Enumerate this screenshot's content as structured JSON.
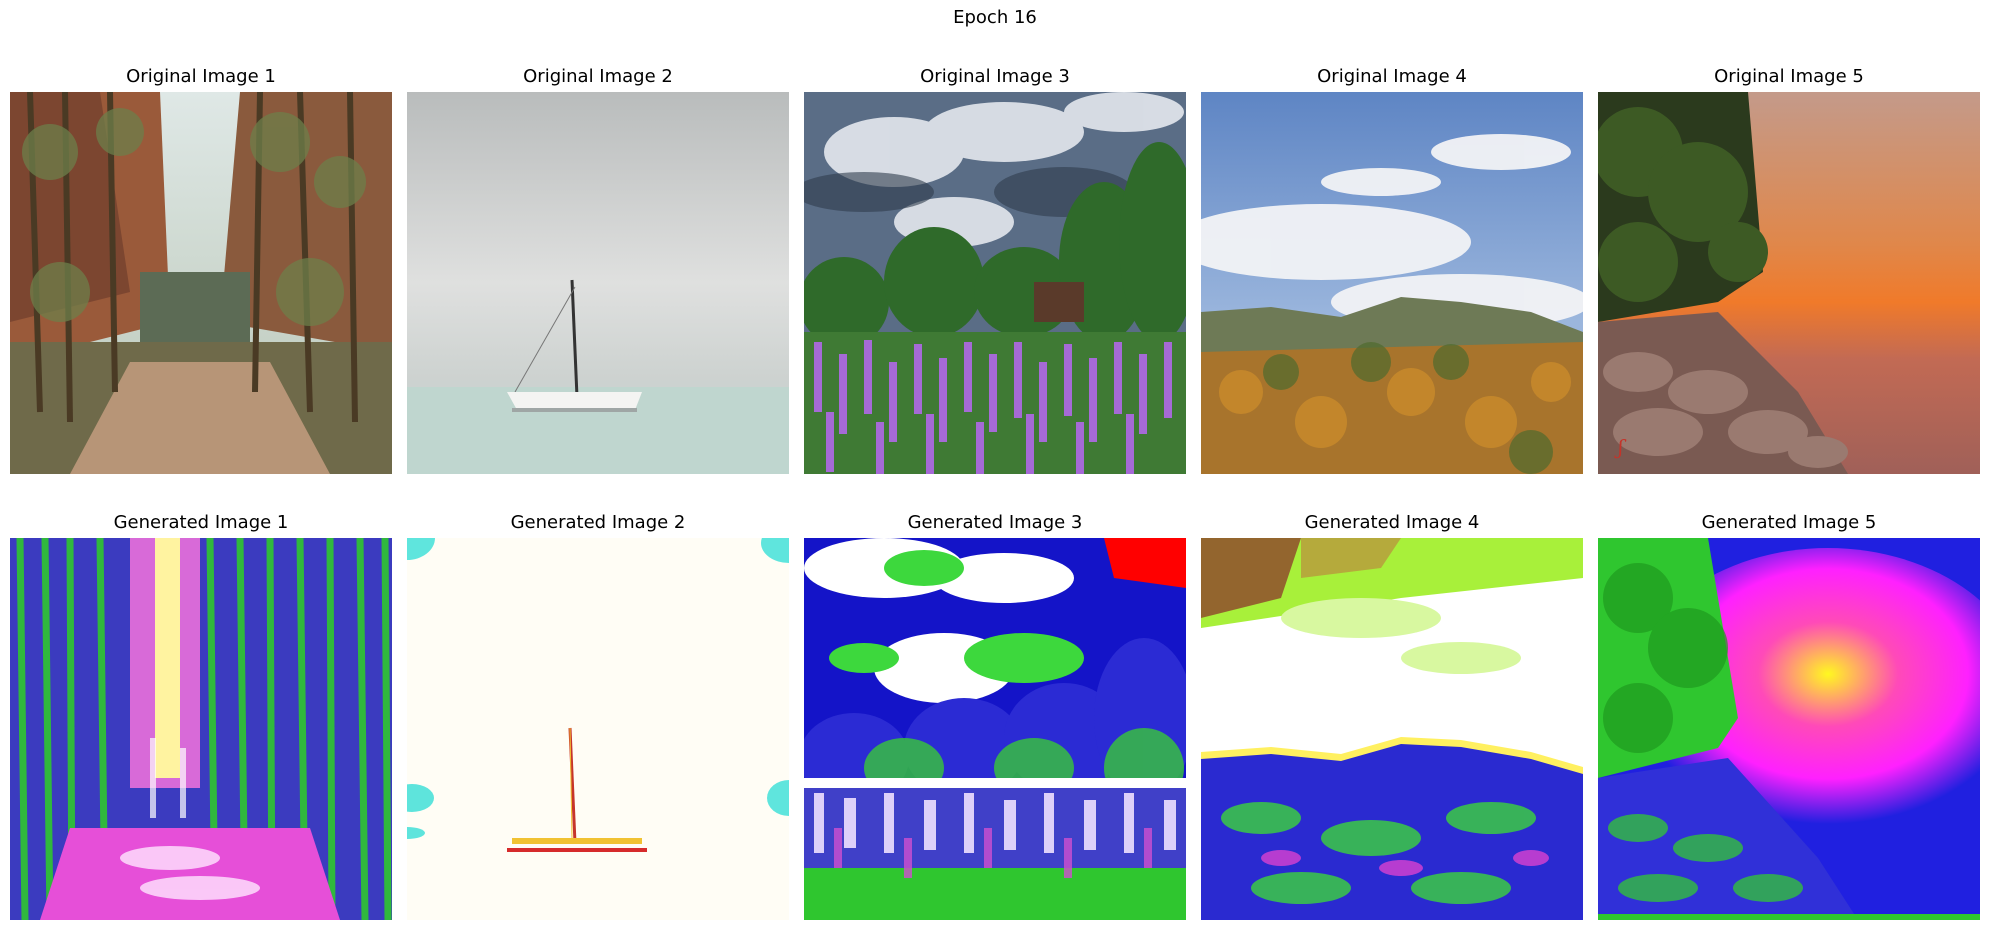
{
  "figure": {
    "title": "Epoch 16"
  },
  "rows": [
    {
      "kind": "original",
      "panels": [
        {
          "title": "Original Image 1",
          "scene": "canyon-forest-path"
        },
        {
          "title": "Original Image 2",
          "scene": "sailboat-sea"
        },
        {
          "title": "Original Image 3",
          "scene": "lupine-field"
        },
        {
          "title": "Original Image 4",
          "scene": "autumn-mountain"
        },
        {
          "title": "Original Image 5",
          "scene": "sunset-lake-rocks"
        }
      ]
    },
    {
      "kind": "generated",
      "panels": [
        {
          "title": "Generated Image 1",
          "scene": "canyon-forest-path-stylized"
        },
        {
          "title": "Generated Image 2",
          "scene": "sailboat-sea-stylized"
        },
        {
          "title": "Generated Image 3",
          "scene": "lupine-field-stylized"
        },
        {
          "title": "Generated Image 4",
          "scene": "autumn-mountain-stylized"
        },
        {
          "title": "Generated Image 5",
          "scene": "sunset-lake-rocks-stylized"
        }
      ]
    }
  ]
}
